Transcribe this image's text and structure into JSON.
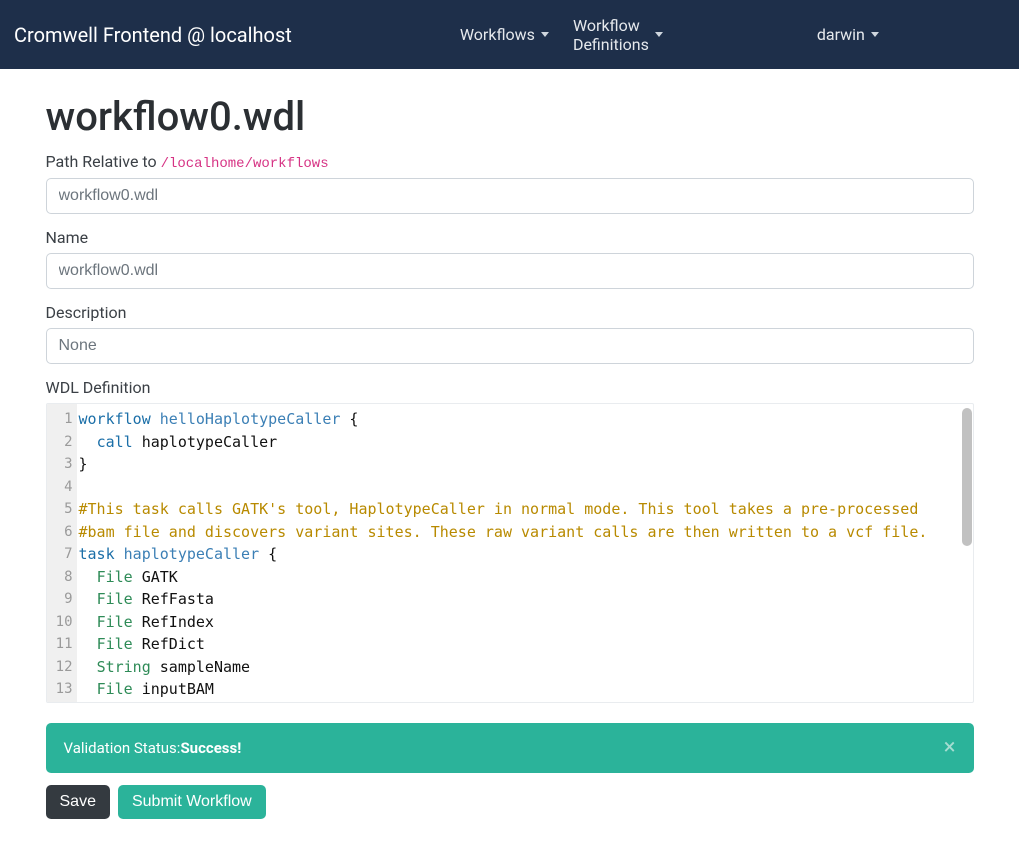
{
  "navbar": {
    "brand": "Cromwell Frontend @ localhost",
    "menu1": "Workflows",
    "menu2": "Workflow Definitions",
    "user": "darwin"
  },
  "page": {
    "title": "workflow0.wdl"
  },
  "form": {
    "path": {
      "label_prefix": "Path Relative to ",
      "base_path": "/localhome/workflows",
      "value": "workflow0.wdl"
    },
    "name": {
      "label": "Name",
      "value": "workflow0.wdl"
    },
    "description": {
      "label": "Description",
      "value": "None"
    },
    "wdl": {
      "label": "WDL Definition"
    }
  },
  "editor": {
    "lines": [
      {
        "n": 1,
        "tokens": [
          [
            "kw",
            "workflow"
          ],
          [
            "txt",
            " "
          ],
          [
            "name",
            "helloHaplotypeCaller"
          ],
          [
            "txt",
            " {"
          ]
        ]
      },
      {
        "n": 2,
        "tokens": [
          [
            "txt",
            "  "
          ],
          [
            "kw",
            "call"
          ],
          [
            "txt",
            " haplotypeCaller"
          ]
        ]
      },
      {
        "n": 3,
        "tokens": [
          [
            "txt",
            "}"
          ]
        ]
      },
      {
        "n": 4,
        "tokens": []
      },
      {
        "n": 5,
        "tokens": [
          [
            "comment",
            "#This task calls GATK's tool, HaplotypeCaller in normal mode. This tool takes a pre-processed "
          ]
        ]
      },
      {
        "n": 6,
        "tokens": [
          [
            "comment",
            "#bam file and discovers variant sites. These raw variant calls are then written to a vcf file. "
          ]
        ]
      },
      {
        "n": 7,
        "tokens": [
          [
            "kw",
            "task"
          ],
          [
            "txt",
            " "
          ],
          [
            "name",
            "haplotypeCaller"
          ],
          [
            "txt",
            " {"
          ]
        ]
      },
      {
        "n": 8,
        "tokens": [
          [
            "txt",
            "  "
          ],
          [
            "type",
            "File"
          ],
          [
            "txt",
            " GATK"
          ]
        ]
      },
      {
        "n": 9,
        "tokens": [
          [
            "txt",
            "  "
          ],
          [
            "type",
            "File"
          ],
          [
            "txt",
            " RefFasta"
          ]
        ]
      },
      {
        "n": 10,
        "tokens": [
          [
            "txt",
            "  "
          ],
          [
            "type",
            "File"
          ],
          [
            "txt",
            " RefIndex"
          ]
        ]
      },
      {
        "n": 11,
        "tokens": [
          [
            "txt",
            "  "
          ],
          [
            "type",
            "File"
          ],
          [
            "txt",
            " RefDict"
          ]
        ]
      },
      {
        "n": 12,
        "tokens": [
          [
            "txt",
            "  "
          ],
          [
            "type",
            "String"
          ],
          [
            "txt",
            " sampleName"
          ]
        ]
      },
      {
        "n": 13,
        "tokens": [
          [
            "txt",
            "  "
          ],
          [
            "type",
            "File"
          ],
          [
            "txt",
            " inputBAM"
          ]
        ]
      }
    ]
  },
  "alert": {
    "prefix": "Validation Status: ",
    "status": "Success!"
  },
  "buttons": {
    "save": "Save",
    "submit": "Submit Workflow"
  }
}
